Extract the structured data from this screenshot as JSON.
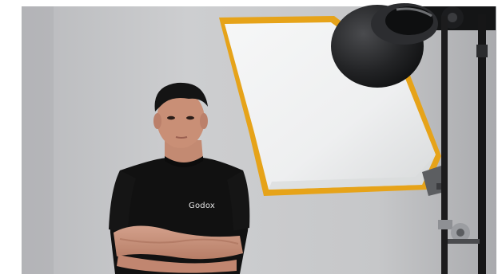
{
  "photo": {
    "shirt_logo_text": "Godox",
    "colors": {
      "border": "#ffffff",
      "background_wall": "#c9c9cb",
      "wall_shadow": "#a8a9ad",
      "reflector_frame": "#e6a319",
      "reflector_panel": "#f2f3f3",
      "light_body": "#1b1c1e",
      "tshirt": "#111111",
      "skin": "#c98f76",
      "hair": "#141414",
      "stand": "#1f1f1f"
    }
  }
}
